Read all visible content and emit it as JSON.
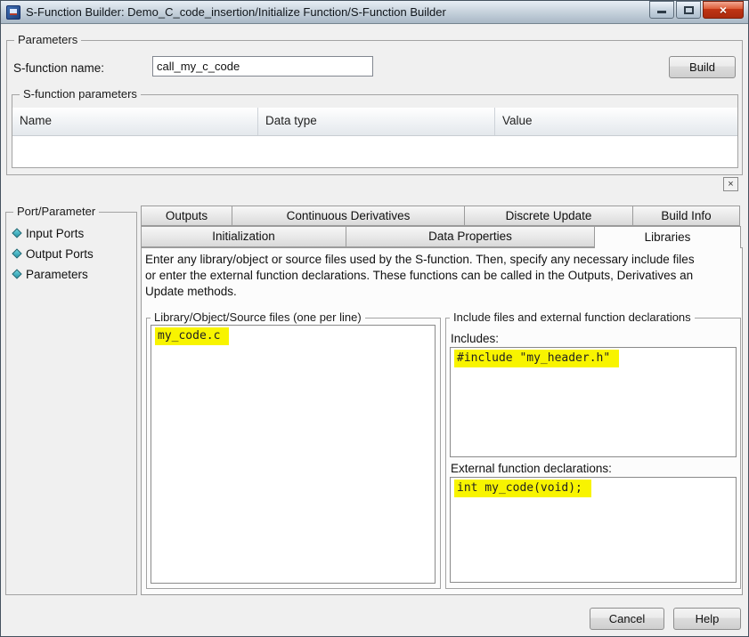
{
  "window": {
    "title": "S-Function Builder: Demo_C_code_insertion/Initialize Function/S-Function Builder",
    "controls": {
      "close_glyph": "×"
    }
  },
  "parameters": {
    "legend": "Parameters",
    "name_label": "S-function name:",
    "name_value": "call_my_c_code",
    "build_button": "Build",
    "dismiss_glyph": "×",
    "sfp": {
      "legend": "S-function parameters",
      "columns": [
        "Name",
        "Data type",
        "Value"
      ]
    }
  },
  "port_parameter": {
    "legend": "Port/Parameter",
    "items": [
      "Input Ports",
      "Output Ports",
      "Parameters"
    ]
  },
  "tabs": {
    "row1": [
      "Outputs",
      "Continuous Derivatives",
      "Discrete Update",
      "Build Info"
    ],
    "row2": [
      "Initialization",
      "Data Properties",
      "Libraries"
    ],
    "active": "Libraries"
  },
  "libraries_tab": {
    "description_lines": [
      "Enter any library/object or source files used by the S-function. Then, specify any necessary include files",
      "or enter the external function declarations. These functions can be called in the Outputs, Derivatives an",
      "Update methods."
    ],
    "source_files": {
      "legend": "Library/Object/Source files (one per line)",
      "content": "my_code.c"
    },
    "includes": {
      "legend": "Include files and external function declarations",
      "includes_label": "Includes:",
      "includes_content": "#include \"my_header.h\"",
      "extern_label": "External function declarations:",
      "extern_content": "int my_code(void);"
    }
  },
  "footer": {
    "cancel": "Cancel",
    "help": "Help"
  },
  "colors": {
    "highlight": "#f8f400",
    "close_button_red": "#c03414",
    "tree_diamond": "#2fa8b8",
    "dialog_bg": "#f0f0f0"
  }
}
